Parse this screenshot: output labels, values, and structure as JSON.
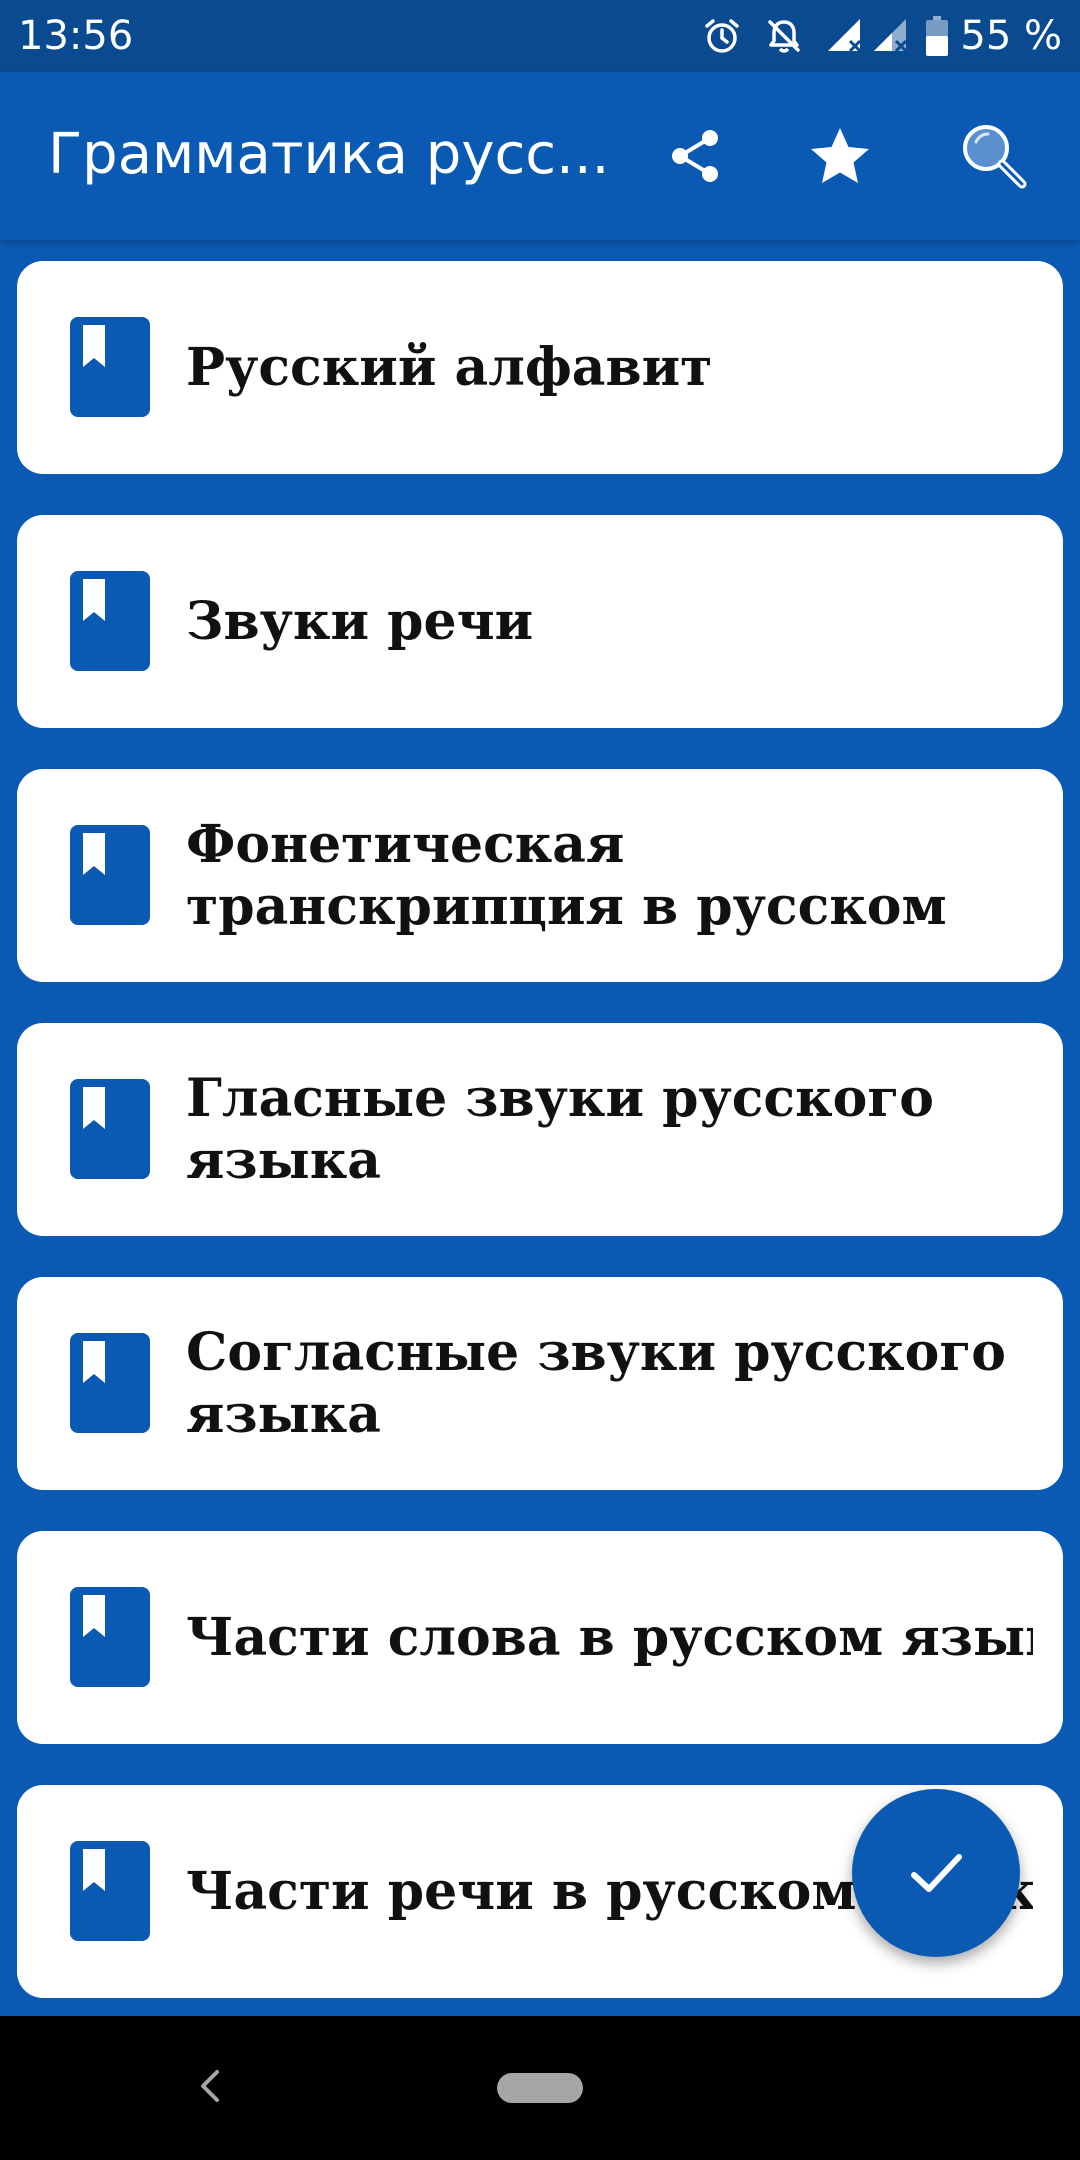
{
  "status_bar": {
    "time": "13:56",
    "battery": "55 %",
    "icons": [
      "alarm-icon",
      "notifications-off-icon",
      "signal-1-icon",
      "signal-2-icon",
      "battery-icon"
    ]
  },
  "app_bar": {
    "title": "Грамматика русс...",
    "actions": [
      "share-icon",
      "star-icon",
      "search-icon"
    ]
  },
  "items": [
    {
      "label": "Русский алфавит",
      "icon": "bookmark-book-icon"
    },
    {
      "label": "Звуки речи",
      "icon": "bookmark-book-icon"
    },
    {
      "label": "Фонетическая транскрипция в русском",
      "icon": "bookmark-book-icon"
    },
    {
      "label": "Гласные звуки русского языка",
      "icon": "bookmark-book-icon"
    },
    {
      "label": "Согласные звуки русского языка",
      "icon": "bookmark-book-icon"
    },
    {
      "label": "Части слова в русском языке",
      "icon": "bookmark-book-icon"
    },
    {
      "label": "Части речи в русском языке",
      "icon": "bookmark-book-icon"
    }
  ],
  "fab": {
    "icon": "check-icon"
  },
  "nav_bar": {
    "icons": [
      "back-icon",
      "home-pill-icon"
    ]
  },
  "colors": {
    "primary": "#0a5ab4",
    "status_bar": "#094a90",
    "card": "#ffffff",
    "text": "#111111"
  }
}
